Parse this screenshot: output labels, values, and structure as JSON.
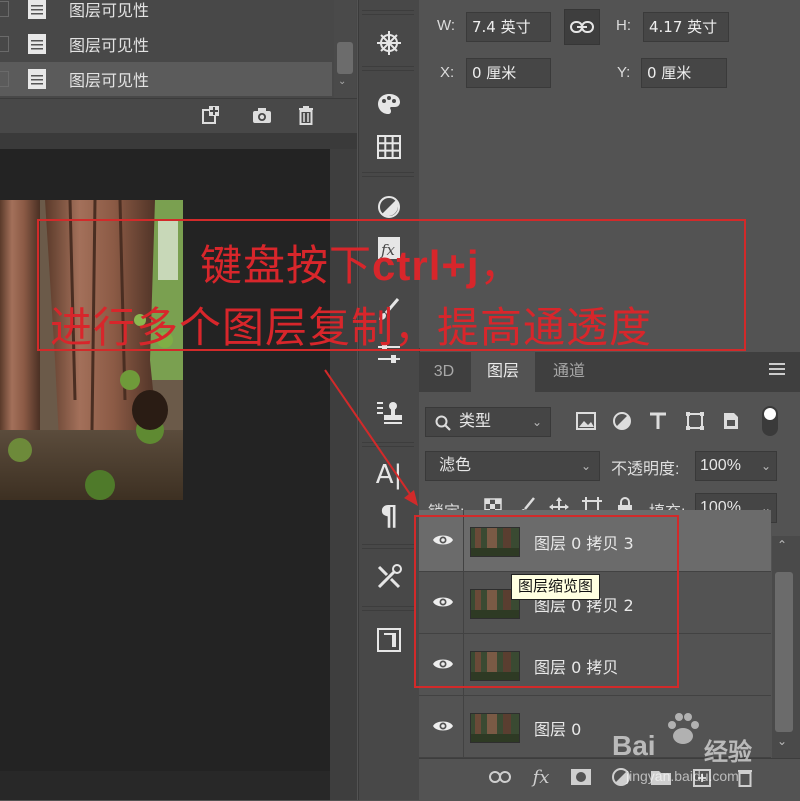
{
  "history": {
    "items": [
      {
        "label": "图层可见性"
      },
      {
        "label": "图层可见性"
      },
      {
        "label": "图层可见性",
        "selected": true
      }
    ]
  },
  "properties": {
    "w_label": "W:",
    "w_value": "7.4 英寸",
    "h_label": "H:",
    "h_value": "4.17 英寸",
    "x_label": "X:",
    "x_value": "0 厘米",
    "y_label": "Y:",
    "y_value": "0 厘米"
  },
  "toolbar": {
    "icons": [
      "vector-cross-icon",
      "palette-icon",
      "grid-icon",
      "adjustments-icon",
      "fx-icon",
      "brush-icon",
      "sliders-icon",
      "stamp-icon",
      "character-icon",
      "paragraph-icon",
      "tools-icon",
      "artboard-icon"
    ],
    "character_label": "A|",
    "paragraph_label": "¶"
  },
  "layers_panel": {
    "tabs": [
      "3D",
      "图层",
      "通道"
    ],
    "active_tab": "图层",
    "filter_label": "类型",
    "blend_mode": "滤色",
    "opacity_label": "不透明度:",
    "opacity_value": "100%",
    "lock_label": "锁定:",
    "fill_label": "填充:",
    "fill_value": "100%",
    "layers": [
      {
        "name": "图层 0 拷贝 3",
        "visible": true,
        "selected": true
      },
      {
        "name": "图层 0 拷贝 2",
        "visible": true,
        "selected": false
      },
      {
        "name": "图层 0 拷贝",
        "visible": true,
        "selected": false
      },
      {
        "name": "图层 0",
        "visible": true,
        "selected": false
      }
    ],
    "tooltip": "图层缩览图",
    "footer_fx": "fx"
  },
  "annotation": {
    "line1_prefix": "键盘按下",
    "line1_bold": "ctrl+j",
    "line1_suffix": "，",
    "line2": "进行多个图层复制，提高通透度",
    "color": "#d8262b"
  },
  "watermark": {
    "brand_left": "Bai",
    "brand_right": "经验",
    "url": "jingyan.baidu.com"
  }
}
